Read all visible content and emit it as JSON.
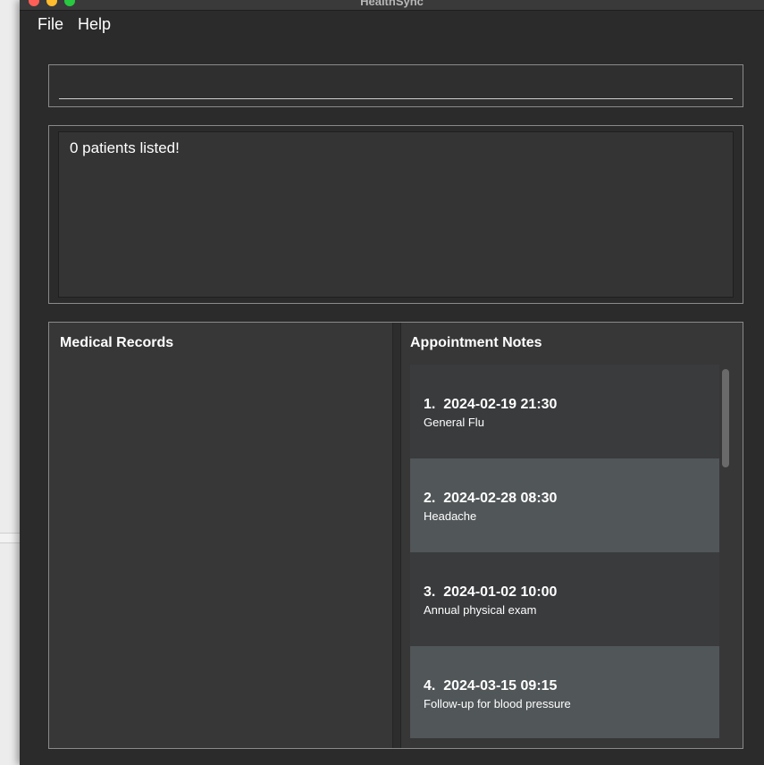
{
  "window": {
    "title": "HealthSync"
  },
  "menu": {
    "file": "File",
    "help": "Help"
  },
  "command": {
    "value": "",
    "placeholder": ""
  },
  "result": {
    "message": "0 patients listed!"
  },
  "panels": {
    "medical_records_title": "Medical Records",
    "appointment_notes_title": "Appointment Notes"
  },
  "appointment_notes": [
    {
      "index": "1.",
      "datetime": "2024-02-19 21:30",
      "description": "General Flu"
    },
    {
      "index": "2.",
      "datetime": "2024-02-28 08:30",
      "description": "Headache"
    },
    {
      "index": "3.",
      "datetime": "2024-01-02 10:00",
      "description": "Annual physical exam"
    },
    {
      "index": "4.",
      "datetime": "2024-03-15 09:15",
      "description": "Follow-up for blood pressure"
    }
  ],
  "colors": {
    "window_bg": "#2b2b2b",
    "panel_bg": "#373737",
    "card_odd": "#3a3b3d",
    "card_even": "#515658",
    "text": "#ffffff"
  }
}
